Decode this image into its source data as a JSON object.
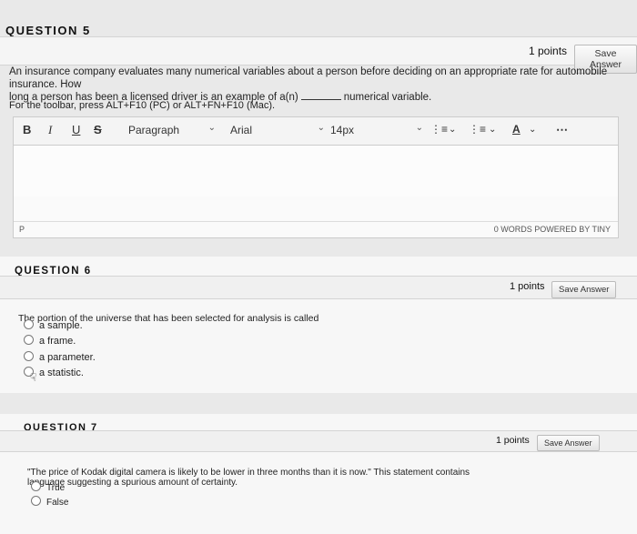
{
  "q5": {
    "title": "QUESTION 5",
    "points": "1 points",
    "save": "Save Answer",
    "text_a": "An insurance company evaluates many numerical variables about a person before deciding on an appropriate rate for automobile insurance. How",
    "text_b": "long a person has been a licensed driver is an example of a(n)",
    "text_c": "numerical variable.",
    "toolbar_hint": "For the toolbar, press ALT+F10 (PC) or ALT+FN+F10 (Mac).",
    "editor": {
      "bold": "B",
      "italic": "I",
      "underline": "U",
      "strike": "S",
      "paragraph": "Paragraph",
      "font": "Arial",
      "size": "14px",
      "path": "P",
      "status": "0 WORDS  POWERED BY TINY"
    }
  },
  "q6": {
    "title": "QUESTION 6",
    "points": "1 points",
    "save": "Save Answer",
    "text": "The portion of the universe that has been selected for analysis is called",
    "options": [
      "a sample.",
      "a frame.",
      "a parameter.",
      "a statistic."
    ]
  },
  "q7": {
    "title": "QUESTION 7",
    "points": "1 points",
    "save": "Save Answer",
    "text_a": "\"The price of Kodak digital camera is likely to be lower in three months than it is now.\" This statement contains",
    "text_b": "language suggesting a spurious amount of certainty.",
    "options": [
      "True",
      "False"
    ]
  }
}
